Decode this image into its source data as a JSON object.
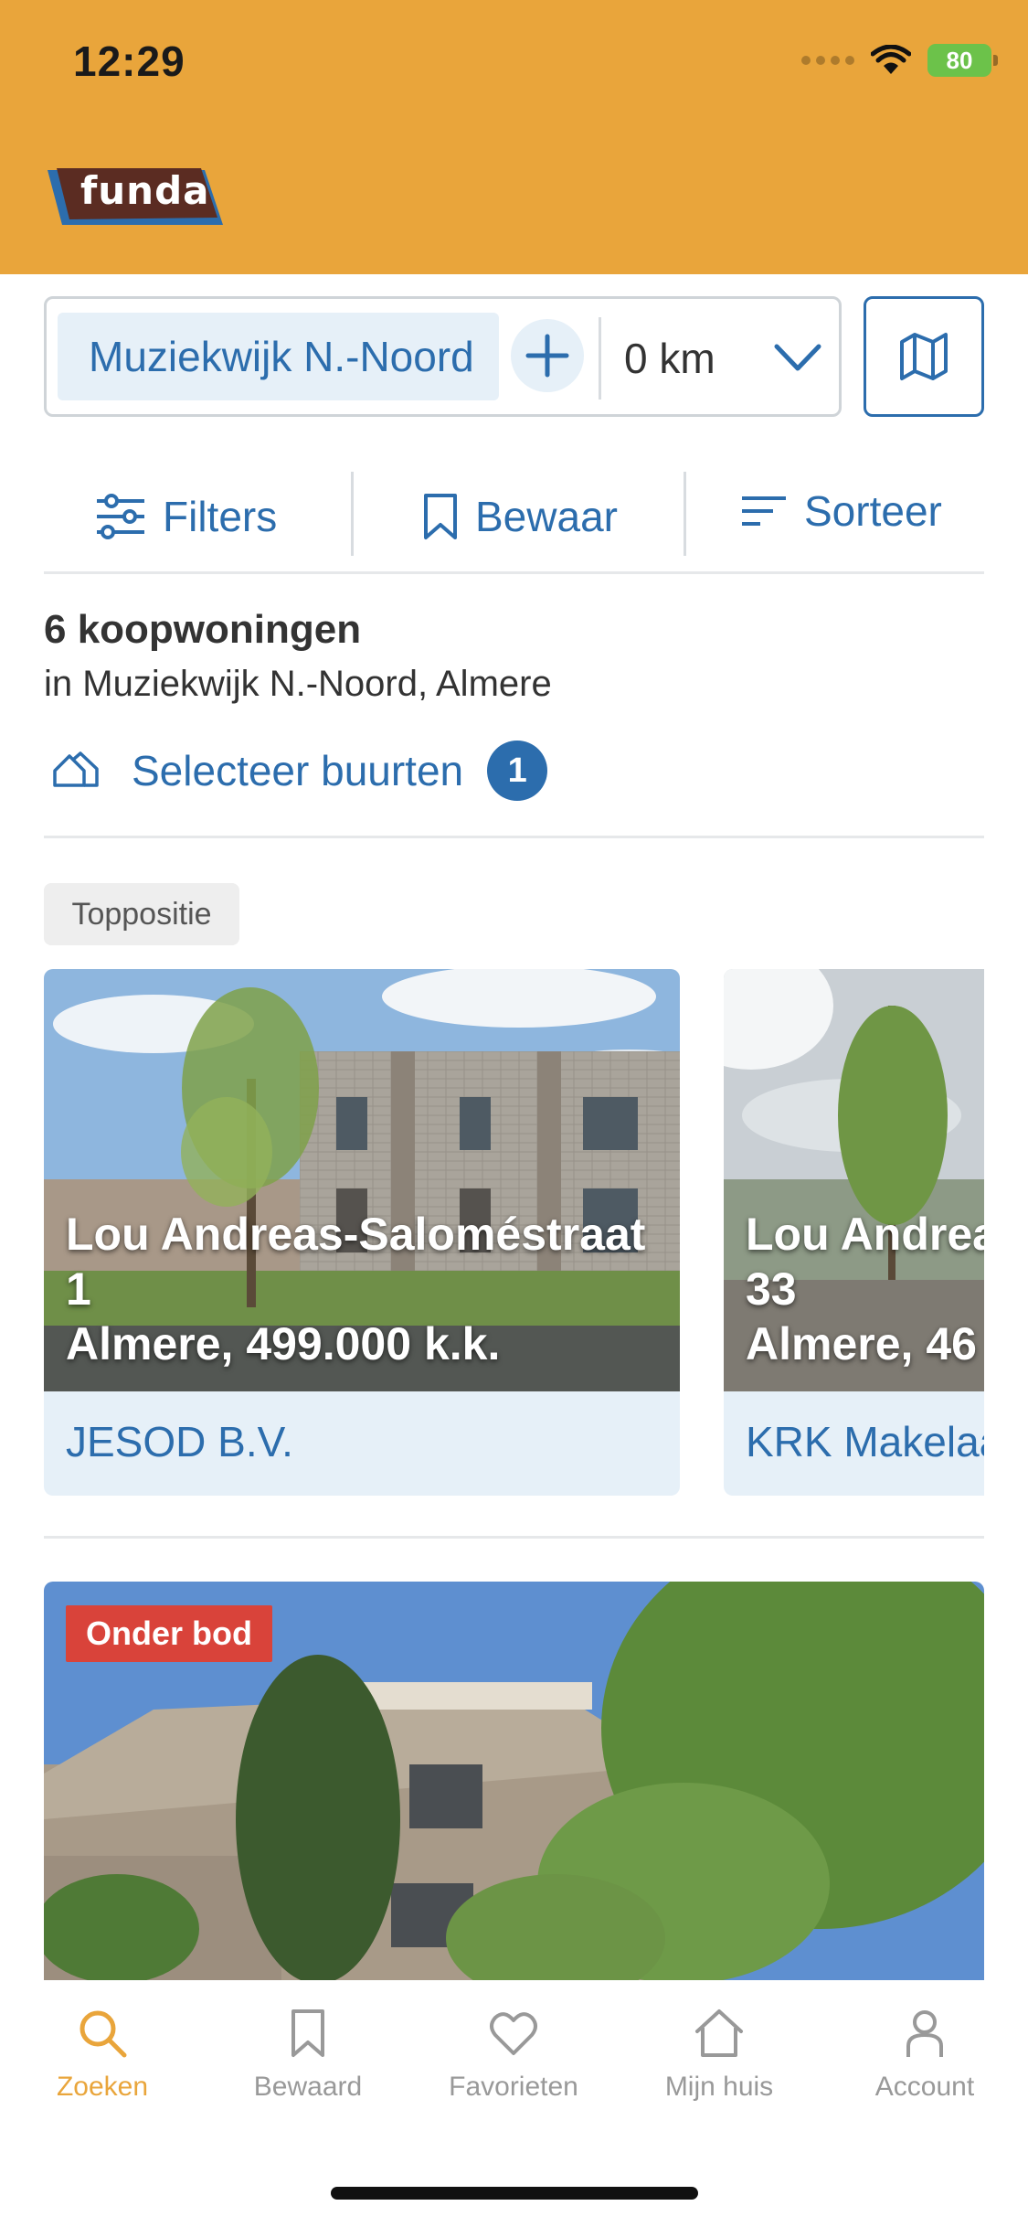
{
  "status_bar": {
    "time": "12:29",
    "battery": "80"
  },
  "app": {
    "brand": "funda",
    "brand_color": "#E9A53B",
    "accent": "#2C6DAD"
  },
  "search": {
    "location": "Muziekwijk N.-Noord",
    "radius": "0 km"
  },
  "toolbar": {
    "filters": "Filters",
    "save": "Bewaar",
    "sort": "Sorteer"
  },
  "results": {
    "count": "6 koopwoningen",
    "location": "in Muziekwijk N.-Noord, Almere",
    "neighbourhoods_label": "Selecteer buurten",
    "neighbourhoods_count": "1"
  },
  "top_position": {
    "badge": "Toppositie",
    "cards": [
      {
        "address_line1": "Lou Andreas-Saloméstraat",
        "address_line2": "1",
        "city_price": "Almere, 499.000 k.k.",
        "agent": "JESOD B.V."
      },
      {
        "address_line1": "Lou Andrea",
        "address_line2": "33",
        "city_price": "Almere, 46",
        "agent": "KRK Makelaa"
      }
    ]
  },
  "listing": {
    "status": "Onder bod"
  },
  "bottom_nav": [
    {
      "label": "Zoeken",
      "icon": "search-icon",
      "active": true
    },
    {
      "label": "Bewaard",
      "icon": "bookmark-icon",
      "active": false
    },
    {
      "label": "Favorieten",
      "icon": "heart-icon",
      "active": false
    },
    {
      "label": "Mijn huis",
      "icon": "home-icon",
      "active": false
    },
    {
      "label": "Account",
      "icon": "person-icon",
      "active": false
    }
  ]
}
